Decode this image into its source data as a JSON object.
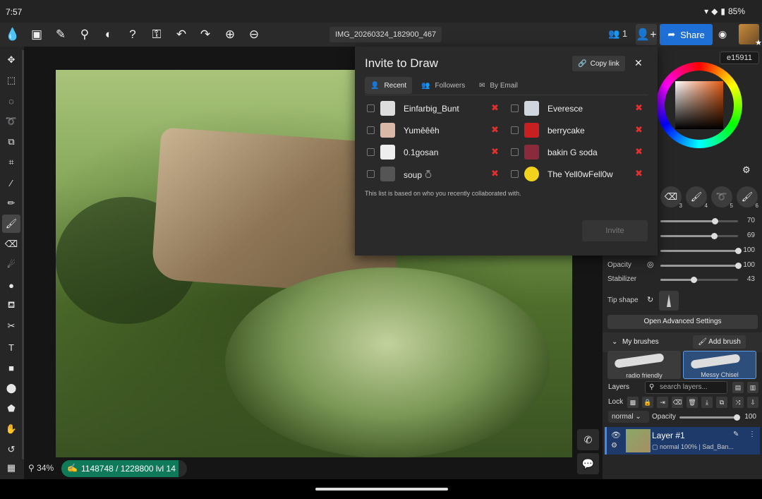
{
  "status": {
    "time": "7:57",
    "battery": "85%"
  },
  "topbar": {
    "filename": "IMG_20260324_182900_467",
    "user_count": "1",
    "share_label": "Share"
  },
  "canvas": {
    "zoom": "34%",
    "progress": "1148748 / 1228800",
    "level": "lvl 14",
    "progress_fraction": 0.935
  },
  "color": {
    "hex": "e15911"
  },
  "brush_slots": [
    "3",
    "4",
    "5",
    "6"
  ],
  "sliders": [
    {
      "label": "",
      "value": "70",
      "fraction": 0.7
    },
    {
      "label": "",
      "value": "69",
      "fraction": 0.69
    },
    {
      "label": "",
      "value": "100",
      "fraction": 1.0
    },
    {
      "label": "Opacity",
      "value": "100",
      "fraction": 1.0
    },
    {
      "label": "Stabilizer",
      "value": "43",
      "fraction": 0.43
    }
  ],
  "brush": {
    "tip_shape_label": "Tip shape",
    "advanced_label": "Open Advanced Settings",
    "my_brushes_label": "My brushes",
    "add_brush_label": "Add brush",
    "thumbs": [
      "radio friendly",
      "Messy Chisel"
    ]
  },
  "layers": {
    "title": "Layers",
    "search_placeholder": "search layers...",
    "lock_label": "Lock",
    "blend_mode": "normal",
    "opacity_label": "Opacity",
    "opacity_value": "100",
    "layer_name": "Layer #1",
    "layer_meta": "normal 100% | Sad_Ban..."
  },
  "dialog": {
    "title": "Invite to Draw",
    "copy_link": "Copy link",
    "tabs": [
      "Recent",
      "Followers",
      "By Email"
    ],
    "people_left": [
      "Einfarbig_Bunt",
      "Yumêêêh",
      "0.1gosan",
      "soup ঁ"
    ],
    "people_right": [
      "Everesce",
      "berrycake",
      "bakin G soda",
      "The Yell0wFell0w"
    ],
    "note": "This list is based on who you recently collaborated with.",
    "invite_label": "Invite"
  }
}
